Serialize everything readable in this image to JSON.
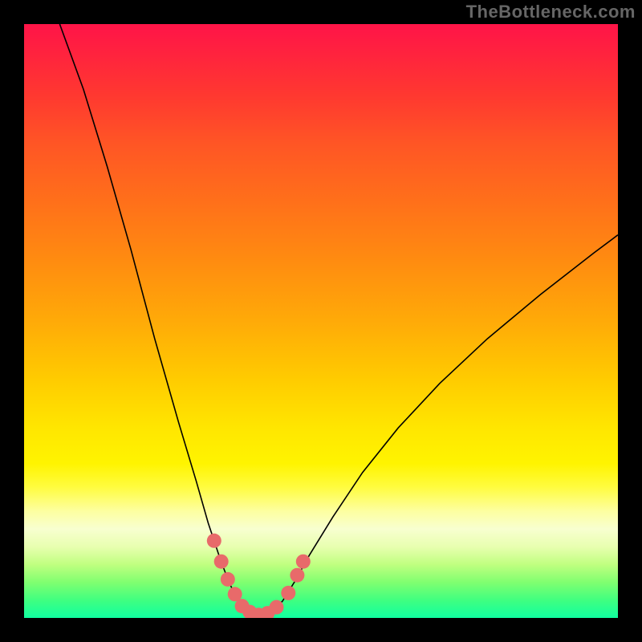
{
  "watermark": "TheBottleneck.com",
  "chart_data": {
    "type": "line",
    "title": "",
    "xlabel": "",
    "ylabel": "",
    "series": [
      {
        "name": "main-curve",
        "color": "#000000",
        "points": [
          {
            "x": 0.06,
            "y": 1.0
          },
          {
            "x": 0.1,
            "y": 0.89
          },
          {
            "x": 0.14,
            "y": 0.76
          },
          {
            "x": 0.18,
            "y": 0.62
          },
          {
            "x": 0.22,
            "y": 0.47
          },
          {
            "x": 0.26,
            "y": 0.33
          },
          {
            "x": 0.29,
            "y": 0.23
          },
          {
            "x": 0.31,
            "y": 0.16
          },
          {
            "x": 0.33,
            "y": 0.1
          },
          {
            "x": 0.345,
            "y": 0.06
          },
          {
            "x": 0.36,
            "y": 0.03
          },
          {
            "x": 0.375,
            "y": 0.012
          },
          {
            "x": 0.395,
            "y": 0.005
          },
          {
            "x": 0.415,
            "y": 0.01
          },
          {
            "x": 0.435,
            "y": 0.028
          },
          {
            "x": 0.455,
            "y": 0.06
          },
          {
            "x": 0.48,
            "y": 0.105
          },
          {
            "x": 0.52,
            "y": 0.17
          },
          {
            "x": 0.57,
            "y": 0.245
          },
          {
            "x": 0.63,
            "y": 0.32
          },
          {
            "x": 0.7,
            "y": 0.395
          },
          {
            "x": 0.78,
            "y": 0.47
          },
          {
            "x": 0.87,
            "y": 0.545
          },
          {
            "x": 0.96,
            "y": 0.615
          },
          {
            "x": 1.0,
            "y": 0.645
          }
        ]
      },
      {
        "name": "highlight-markers",
        "color": "#e86a6a",
        "points": [
          {
            "x": 0.32,
            "y": 0.13
          },
          {
            "x": 0.332,
            "y": 0.095
          },
          {
            "x": 0.343,
            "y": 0.065
          },
          {
            "x": 0.355,
            "y": 0.04
          },
          {
            "x": 0.367,
            "y": 0.02
          },
          {
            "x": 0.38,
            "y": 0.01
          },
          {
            "x": 0.395,
            "y": 0.005
          },
          {
            "x": 0.41,
            "y": 0.008
          },
          {
            "x": 0.425,
            "y": 0.018
          },
          {
            "x": 0.445,
            "y": 0.042
          },
          {
            "x": 0.46,
            "y": 0.072
          },
          {
            "x": 0.47,
            "y": 0.095
          }
        ]
      }
    ],
    "xlim": [
      0,
      1
    ],
    "ylim": [
      0,
      1
    ]
  },
  "colors": {
    "marker": "#e86a6a",
    "curve": "#000000"
  }
}
